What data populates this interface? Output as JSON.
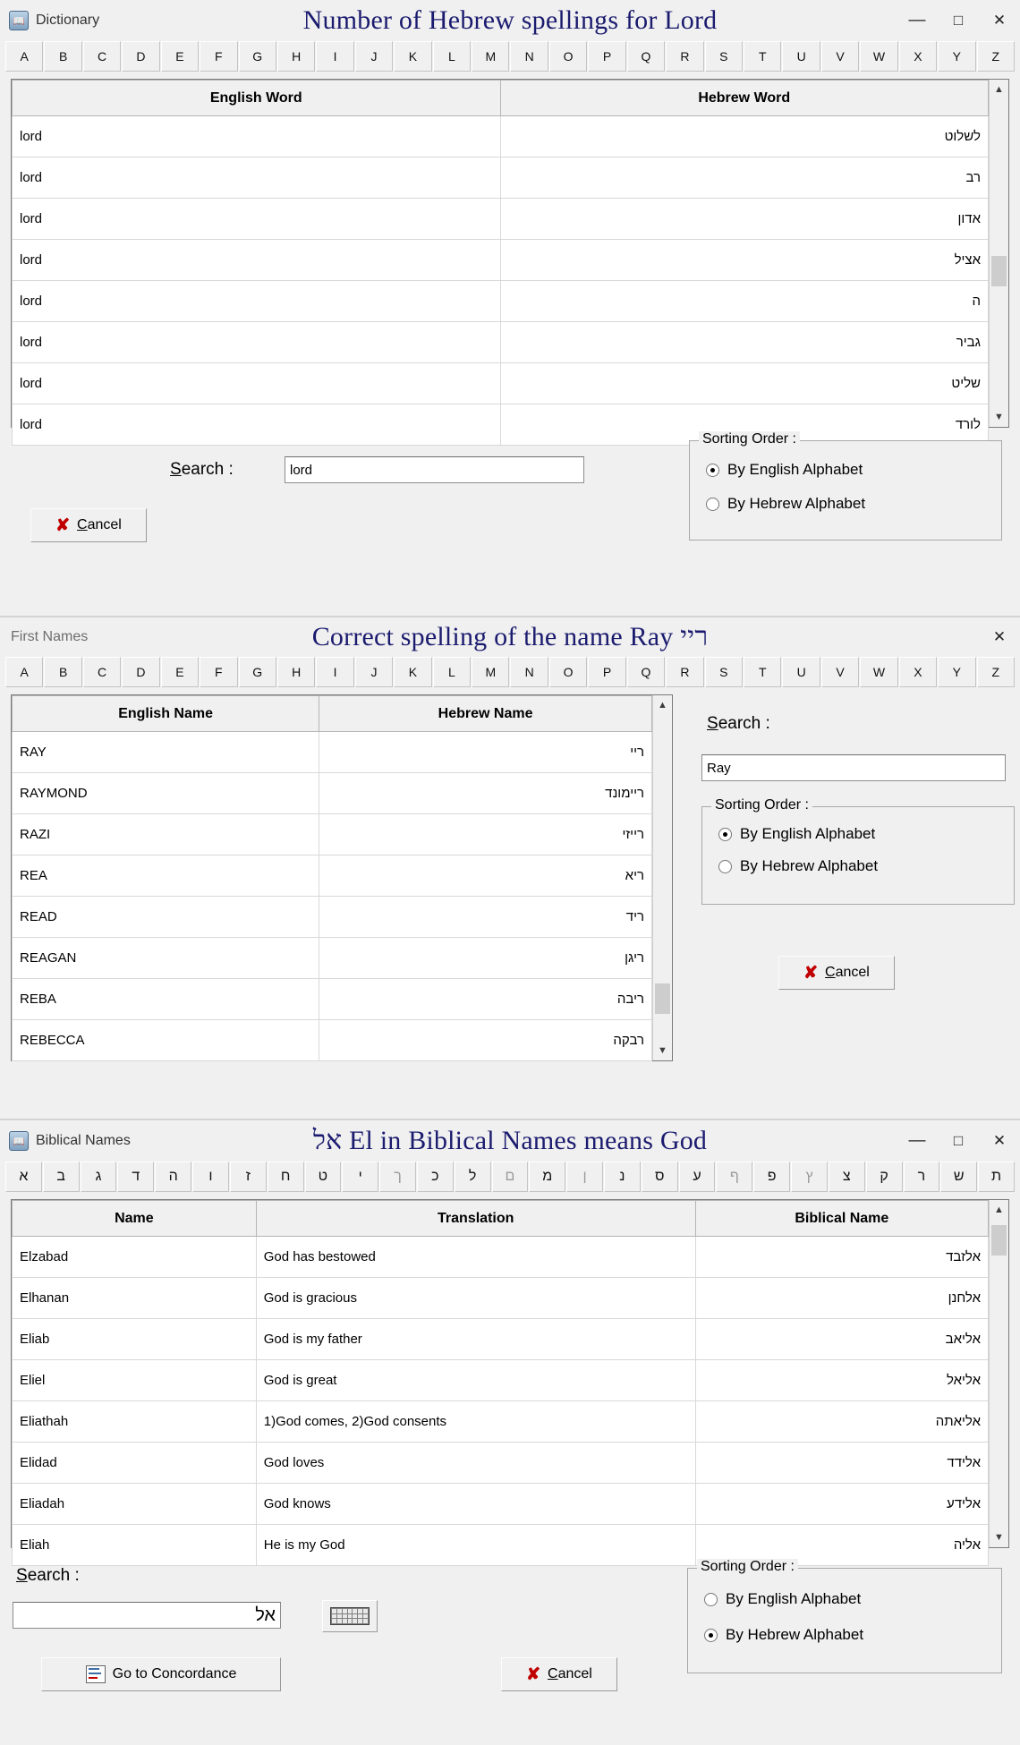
{
  "alphabet_en": [
    "A",
    "B",
    "C",
    "D",
    "E",
    "F",
    "G",
    "H",
    "I",
    "J",
    "K",
    "L",
    "M",
    "N",
    "O",
    "P",
    "Q",
    "R",
    "S",
    "T",
    "U",
    "V",
    "W",
    "X",
    "Y",
    "Z"
  ],
  "alphabet_he": [
    "א",
    "ב",
    "ג",
    "ד",
    "ה",
    "ו",
    "ז",
    "ח",
    "ט",
    "י",
    "ך",
    "כ",
    "ל",
    "ם",
    "מ",
    "ן",
    "נ",
    "ס",
    "ע",
    "ף",
    "פ",
    "ץ",
    "צ",
    "ק",
    "ר",
    "ש",
    "ת"
  ],
  "alphabet_he_dim": [
    "ך",
    "ם",
    "ן",
    "ף",
    "ץ"
  ],
  "panel1": {
    "window_icon": "dictionary-icon",
    "window_label": "Dictionary",
    "caption_overlay": "Number of Hebrew spellings for Lord",
    "buttons": {
      "minimize": "—",
      "maximize": "□",
      "close": "✕"
    },
    "columns": [
      "English Word",
      "Hebrew Word"
    ],
    "rows": [
      {
        "english": "lord",
        "hebrew": "לשלוט"
      },
      {
        "english": "lord",
        "hebrew": "רב"
      },
      {
        "english": "lord",
        "hebrew": "אדון"
      },
      {
        "english": "lord",
        "hebrew": "אציל"
      },
      {
        "english": "lord",
        "hebrew": "ה"
      },
      {
        "english": "lord",
        "hebrew": "גביר"
      },
      {
        "english": "lord",
        "hebrew": "שליט"
      },
      {
        "english": "lord",
        "hebrew": "לורד"
      }
    ],
    "search_label": "Search :",
    "search_value": "lord",
    "sorting_title": "Sorting Order :",
    "sort_english": "By English Alphabet",
    "sort_hebrew": "By Hebrew Alphabet",
    "sort_selected": "english",
    "cancel_label": "Cancel"
  },
  "panel2": {
    "window_label": "First Names",
    "caption_overlay": "Correct spelling of the name Ray  ריי",
    "buttons": {
      "close": "✕"
    },
    "columns": [
      "English Name",
      "Hebrew Name"
    ],
    "rows": [
      {
        "english": "RAY",
        "hebrew": "ריי"
      },
      {
        "english": "RAYMOND",
        "hebrew": "ריימונד"
      },
      {
        "english": "RAZI",
        "hebrew": "רייזי"
      },
      {
        "english": "REA",
        "hebrew": "ריא"
      },
      {
        "english": "READ",
        "hebrew": "ריד"
      },
      {
        "english": "REAGAN",
        "hebrew": "ריגן"
      },
      {
        "english": "REBA",
        "hebrew": "ריבה"
      },
      {
        "english": "REBECCA",
        "hebrew": "רבקה"
      }
    ],
    "search_label": "Search :",
    "search_value": "Ray",
    "sorting_title": "Sorting Order :",
    "sort_english": "By English Alphabet",
    "sort_hebrew": "By Hebrew Alphabet",
    "sort_selected": "english",
    "cancel_label": "Cancel"
  },
  "panel3": {
    "window_icon": "biblical-names-icon",
    "window_label": "Biblical Names",
    "caption_overlay": "אל  El in Biblical Names means God",
    "buttons": {
      "minimize": "—",
      "maximize": "□",
      "close": "✕"
    },
    "columns": [
      "Name",
      "Translation",
      "Biblical Name"
    ],
    "rows": [
      {
        "name": "Elzabad",
        "translation": "God has bestowed",
        "hebrew": "אלזבד"
      },
      {
        "name": "Elhanan",
        "translation": "God is gracious",
        "hebrew": "אלחנן"
      },
      {
        "name": "Eliab",
        "translation": "God is my father",
        "hebrew": "אליאב"
      },
      {
        "name": "Eliel",
        "translation": "God is great",
        "hebrew": "אליאל"
      },
      {
        "name": "Eliathah",
        "translation": "1)God comes, 2)God consents",
        "hebrew": "אליאתה"
      },
      {
        "name": "Elidad",
        "translation": "God loves",
        "hebrew": "אלידד"
      },
      {
        "name": "Eliadah",
        "translation": "God knows",
        "hebrew": "אלידע"
      },
      {
        "name": "Eliah",
        "translation": "He is my God",
        "hebrew": "אליה"
      }
    ],
    "search_label": "Search :",
    "search_value": "אל",
    "keyboard_button": "on-screen-keyboard",
    "sorting_title": "Sorting Order :",
    "sort_english": "By English Alphabet",
    "sort_hebrew": "By Hebrew Alphabet",
    "sort_selected": "hebrew",
    "concordance_label": "Go to Concordance",
    "cancel_label": "Cancel"
  }
}
